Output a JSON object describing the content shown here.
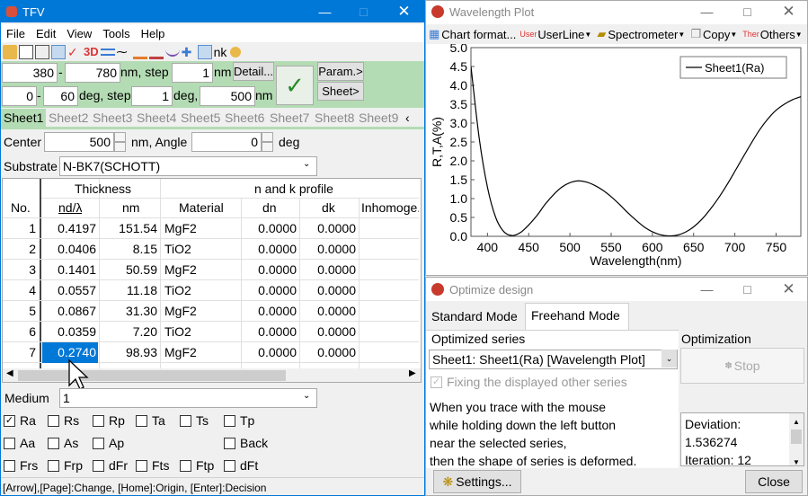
{
  "tfv": {
    "title": "TFV",
    "menu": [
      "File",
      "Edit",
      "View",
      "Tools",
      "Help"
    ],
    "toolbar_icons": [
      "open-icon",
      "save-icon",
      "wavelength-plot-icon",
      "angle-plot-icon",
      "3d-plot-icon",
      "layers-icon",
      "profile-icon",
      "nk-plot-icon",
      "tool-icon",
      "optimize-icon",
      "tool-icon",
      "move-icon",
      "select-icon",
      "nk-icon",
      "settings-icon"
    ],
    "toolbar_3d": "3D",
    "toolbar_nk": "nk",
    "wl_start": "380",
    "wl_sep": "-",
    "wl_end": "780",
    "wl_step_label": "nm, step",
    "wl_step": "1",
    "wl_unit": "nm",
    "detail_button": "Detail...",
    "ang_start": "0",
    "ang_sep": "-",
    "ang_end": "60",
    "ang_step_label": "deg, step",
    "ang_step": "1",
    "ang_unit": "deg,",
    "ang_wl": "500",
    "ang_wl_unit": "nm",
    "ok_symbol": "✓",
    "param_button": "Param.>",
    "sheet_button": "Sheet>",
    "sheets": [
      "Sheet1",
      "Sheet2",
      "Sheet3",
      "Sheet4",
      "Sheet5",
      "Sheet6",
      "Sheet7",
      "Sheet8",
      "Sheet9"
    ],
    "sheet_more": "‹",
    "center_label": "Center",
    "center_value": "500",
    "center_unit": "nm, Angle",
    "angle_value": "0",
    "angle_unit": "deg",
    "substrate_label": "Substrate",
    "substrate_value": "N-BK7(SCHOTT)",
    "table": {
      "group_thickness": "Thickness",
      "group_nk": "n and k profile",
      "col_no": "No.",
      "col_ndl": "nd/λ",
      "col_nm": "nm",
      "col_material": "Material",
      "col_dn": "dn",
      "col_dk": "dk",
      "col_inhomo": "Inhomoge...",
      "rows": [
        {
          "no": "1",
          "ndl": "0.4197",
          "nm": "151.54",
          "material": "MgF2",
          "dn": "0.0000",
          "dk": "0.0000"
        },
        {
          "no": "2",
          "ndl": "0.0406",
          "nm": "8.15",
          "material": "TiO2",
          "dn": "0.0000",
          "dk": "0.0000"
        },
        {
          "no": "3",
          "ndl": "0.1401",
          "nm": "50.59",
          "material": "MgF2",
          "dn": "0.0000",
          "dk": "0.0000"
        },
        {
          "no": "4",
          "ndl": "0.0557",
          "nm": "11.18",
          "material": "TiO2",
          "dn": "0.0000",
          "dk": "0.0000"
        },
        {
          "no": "5",
          "ndl": "0.0867",
          "nm": "31.30",
          "material": "MgF2",
          "dn": "0.0000",
          "dk": "0.0000"
        },
        {
          "no": "6",
          "ndl": "0.0359",
          "nm": "7.20",
          "material": "TiO2",
          "dn": "0.0000",
          "dk": "0.0000"
        },
        {
          "no": "7",
          "ndl": "0.2740",
          "nm": "98.93",
          "material": "MgF2",
          "dn": "0.0000",
          "dk": "0.0000"
        }
      ]
    },
    "medium_label": "Medium",
    "medium_value": "1",
    "checks": [
      {
        "label": "Ra",
        "checked": true
      },
      {
        "label": "Rs",
        "checked": false
      },
      {
        "label": "Rp",
        "checked": false
      },
      {
        "label": "Ta",
        "checked": false
      },
      {
        "label": "Ts",
        "checked": false
      },
      {
        "label": "Tp",
        "checked": false
      },
      {
        "label": "Aa",
        "checked": false
      },
      {
        "label": "As",
        "checked": false
      },
      {
        "label": "Ap",
        "checked": false
      },
      {
        "label": "Back",
        "checked": false
      },
      {
        "label": "Frs",
        "checked": false
      },
      {
        "label": "Frp",
        "checked": false
      },
      {
        "label": "dFr",
        "checked": false
      },
      {
        "label": "Fts",
        "checked": false
      },
      {
        "label": "Ftp",
        "checked": false
      },
      {
        "label": "dFt",
        "checked": false
      }
    ],
    "status": "[Arrow],[Page]:Change, [Home]:Origin, [Enter]:Decision"
  },
  "plot": {
    "title": "Wavelength Plot",
    "menu_chart": "Chart format...",
    "menu_user_icon": "User",
    "menu_user": "UserLine",
    "menu_spectro": "Spectrometer",
    "menu_copy": "Copy",
    "menu_others_icon": "Ther",
    "menu_others": "Others",
    "legend": "Sheet1(Ra)"
  },
  "chart_data": {
    "type": "line",
    "xlabel": "Wavelength(nm)",
    "ylabel": "R,T,A(%)",
    "xlim": [
      380,
      780
    ],
    "ylim": [
      0,
      5.0
    ],
    "xticks": [
      "400",
      "450",
      "500",
      "550",
      "600",
      "650",
      "700",
      "750"
    ],
    "yticks": [
      "0.0",
      "0.5",
      "1.0",
      "1.5",
      "2.0",
      "2.5",
      "3.0",
      "3.5",
      "4.0",
      "4.5",
      "5.0"
    ],
    "grid": false,
    "legend_position": "top-right",
    "series": [
      {
        "name": "Sheet1(Ra)",
        "x": [
          380,
          390,
          400,
          410,
          420,
          430,
          440,
          450,
          460,
          470,
          480,
          490,
          500,
          510,
          520,
          530,
          540,
          550,
          560,
          570,
          580,
          590,
          600,
          610,
          620,
          630,
          640,
          650,
          660,
          670,
          680,
          690,
          700,
          710,
          720,
          730,
          740,
          750,
          760,
          770,
          780
        ],
        "y": [
          4.5,
          2.6,
          1.3,
          0.5,
          0.12,
          0.02,
          0.1,
          0.3,
          0.55,
          0.85,
          1.1,
          1.3,
          1.42,
          1.47,
          1.44,
          1.35,
          1.22,
          1.05,
          0.85,
          0.63,
          0.43,
          0.25,
          0.12,
          0.04,
          0.01,
          0.03,
          0.11,
          0.25,
          0.45,
          0.71,
          1.01,
          1.35,
          1.72,
          2.1,
          2.47,
          2.82,
          3.11,
          3.34,
          3.5,
          3.62,
          3.7
        ]
      }
    ]
  },
  "optimize": {
    "title": "Optimize design",
    "tab_standard": "Standard Mode",
    "tab_freehand": "Freehand Mode",
    "series_group": "Optimized series",
    "series_value": "Sheet1: Sheet1(Ra) [Wavelength Plot]",
    "fix_label": "Fixing the displayed other series",
    "desc_lines": [
      "When you trace with the mouse",
      "while holding down the left button",
      "near the selected series,",
      "then the shape of series is deformed."
    ],
    "opt_group": "Optimization",
    "stop_button": "Stop",
    "deviation_label": "Deviation:",
    "deviation_value": "1.536274",
    "iteration_label": "Iteration:",
    "iteration_value": "12",
    "settings_button": "Settings...",
    "close_button": "Close"
  },
  "colors": {
    "titlebar_blue": "#0078d7",
    "toolbar_green": "#b4dcb4",
    "selection": "#0078d7",
    "plot_bg": "#ffffff"
  }
}
